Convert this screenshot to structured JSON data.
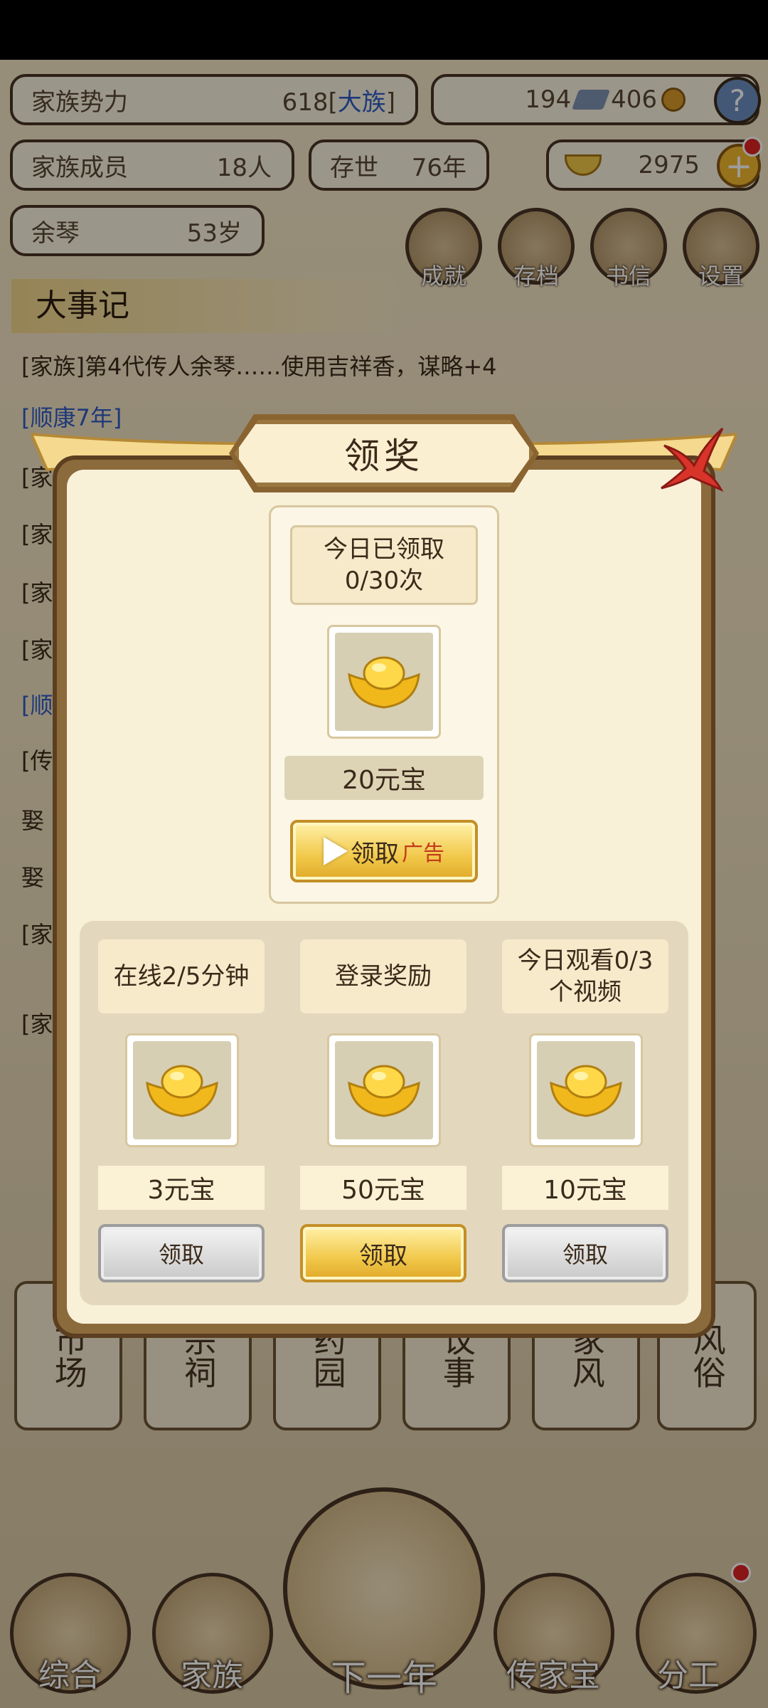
{
  "header": {
    "clan_power": {
      "label": "家族势力",
      "value": "618[",
      "rank": "大族",
      "close": "]"
    },
    "silver": "194",
    "copper": "406",
    "members": {
      "label": "家族成员",
      "value": "18人"
    },
    "existence": {
      "label": "存世",
      "value": "76年"
    },
    "gold": "2975",
    "leader": {
      "name": "余琴",
      "age": "53岁"
    },
    "buttons": [
      "成就",
      "存档",
      "书信",
      "设置"
    ],
    "help": "?",
    "plus": "+"
  },
  "chronicle": {
    "title": "大事记",
    "lines": [
      {
        "text": "[家族]第4代传人余琴……使用吉祥香，谋略+4",
        "type": "normal"
      },
      {
        "text": "[顺康7年]",
        "type": "blue"
      },
      {
        "text": "[家",
        "type": "normal"
      },
      {
        "text": "[家",
        "type": "normal"
      },
      {
        "text": "[家",
        "type": "normal"
      },
      {
        "text": "[家",
        "type": "normal"
      },
      {
        "text": "[顺",
        "type": "blue"
      },
      {
        "text": "[传",
        "type": "normal"
      },
      {
        "text": "娶",
        "type": "normal"
      },
      {
        "text": "娶",
        "type": "normal"
      },
      {
        "text": "[家",
        "type": "normal"
      },
      {
        "text": "[家",
        "type": "normal"
      }
    ]
  },
  "buildings": [
    "市场",
    "宗祠",
    "药园",
    "议事",
    "家风",
    "风俗"
  ],
  "nav": [
    "综合",
    "家族",
    "下一年",
    "传家宝",
    "分工"
  ],
  "dialog": {
    "title": "领奖",
    "ad_reward": {
      "status_line1": "今日已领取",
      "status_line2": "0/30次",
      "amount": "20元宝",
      "button_label": "领取",
      "ad_tag": "广告"
    },
    "rewards": [
      {
        "label": "在线2/5分钟",
        "amount": "3元宝",
        "button_label": "领取",
        "state": "disabled"
      },
      {
        "label": "登录奖励",
        "amount": "50元宝",
        "button_label": "领取",
        "state": "active"
      },
      {
        "label_line1": "今日观看0/3",
        "label_line2": "个视频",
        "amount": "10元宝",
        "button_label": "领取",
        "state": "disabled"
      }
    ]
  },
  "colors": {
    "gold": "#f1c84a",
    "panel": "#f9f0d8",
    "frame": "#8b6a3c",
    "ribbon_red": "#d8342a"
  }
}
